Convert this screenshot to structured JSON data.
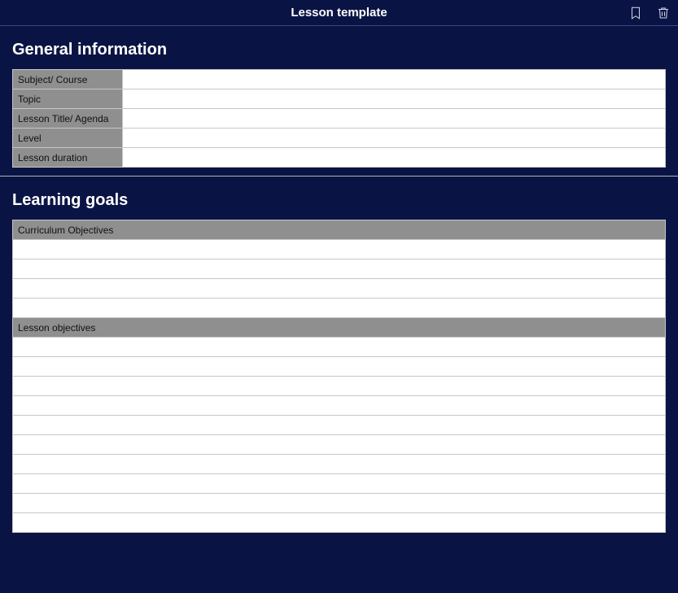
{
  "header": {
    "title": "Lesson template"
  },
  "sections": {
    "general": {
      "title": "General information",
      "rows": [
        {
          "label": "Subject/ Course",
          "value": ""
        },
        {
          "label": "Topic",
          "value": ""
        },
        {
          "label": "Lesson Title/ Agenda",
          "value": ""
        },
        {
          "label": "Level",
          "value": ""
        },
        {
          "label": "Lesson duration",
          "value": ""
        }
      ]
    },
    "goals": {
      "title": "Learning goals",
      "subheads": {
        "curriculum": "Curriculum Objectives",
        "lesson": "Lesson objectives"
      }
    }
  }
}
